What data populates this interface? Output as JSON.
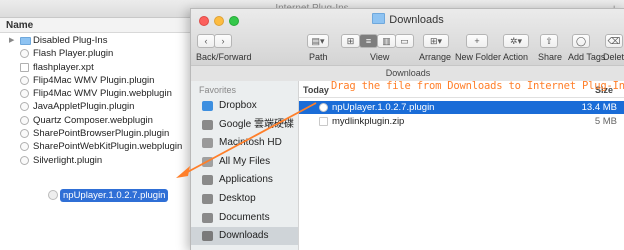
{
  "back_window": {
    "title": "Internet Plug-Ins",
    "column_header": "Name",
    "items": [
      {
        "label": "Disabled Plug-Ins",
        "type": "folder",
        "expand": "▶"
      },
      {
        "label": "Flash Player.plugin",
        "type": "plugin"
      },
      {
        "label": "flashplayer.xpt",
        "type": "doc"
      },
      {
        "label": "Flip4Mac WMV Plugin.plugin",
        "type": "plugin"
      },
      {
        "label": "Flip4Mac WMV Plugin.webplugin",
        "type": "plugin"
      },
      {
        "label": "JavaAppletPlugin.plugin",
        "type": "plugin"
      },
      {
        "label": "Quartz Composer.webplugin",
        "type": "plugin"
      },
      {
        "label": "SharePointBrowserPlugin.plugin",
        "type": "plugin"
      },
      {
        "label": "SharePointWebKitPlugin.webplugin",
        "type": "plugin"
      },
      {
        "label": "Silverlight.plugin",
        "type": "plugin"
      }
    ],
    "dragged_item": "npUplayer.1.0.2.7.plugin",
    "add_tab": "+"
  },
  "front_window": {
    "title": "Downloads",
    "toolbar": {
      "back_forward_label": "Back/Forward",
      "path_label": "Path",
      "view_label": "View",
      "arrange_label": "Arrange",
      "new_folder_label": "New Folder",
      "action_label": "Action",
      "share_label": "Share",
      "add_tags_label": "Add Tags",
      "delete_label": "Delete"
    },
    "path_strip": "Downloads",
    "sidebar": {
      "heading": "Favorites",
      "items": [
        {
          "label": "Dropbox",
          "icon": "dropbox-icon",
          "color": "#3d8fe0"
        },
        {
          "label": "Google 雲端硬碟",
          "icon": "google-drive-icon",
          "color": "#8a8a8a"
        },
        {
          "label": "Macintosh HD",
          "icon": "hard-drive-icon",
          "color": "#9a9a9a"
        },
        {
          "label": "All My Files",
          "icon": "all-files-icon",
          "color": "#a0a0a0"
        },
        {
          "label": "Applications",
          "icon": "applications-icon",
          "color": "#8a8a8a"
        },
        {
          "label": "Desktop",
          "icon": "desktop-icon",
          "color": "#8a8a8a"
        },
        {
          "label": "Documents",
          "icon": "documents-icon",
          "color": "#8a8a8a"
        },
        {
          "label": "Downloads",
          "icon": "downloads-icon",
          "color": "#7a7a7a"
        }
      ]
    },
    "columns": {
      "date_group": "Today",
      "size": "Size"
    },
    "files": [
      {
        "name": "npUplayer.1.0.2.7.plugin",
        "size": "13.4 MB",
        "selected": true
      },
      {
        "name": "mydlinkplugin.zip",
        "size": "5 MB",
        "selected": false
      }
    ]
  },
  "annotation": {
    "text": "Drag the file from Downloads to Internet Plug-Ins",
    "color": "#ff7f2a"
  }
}
